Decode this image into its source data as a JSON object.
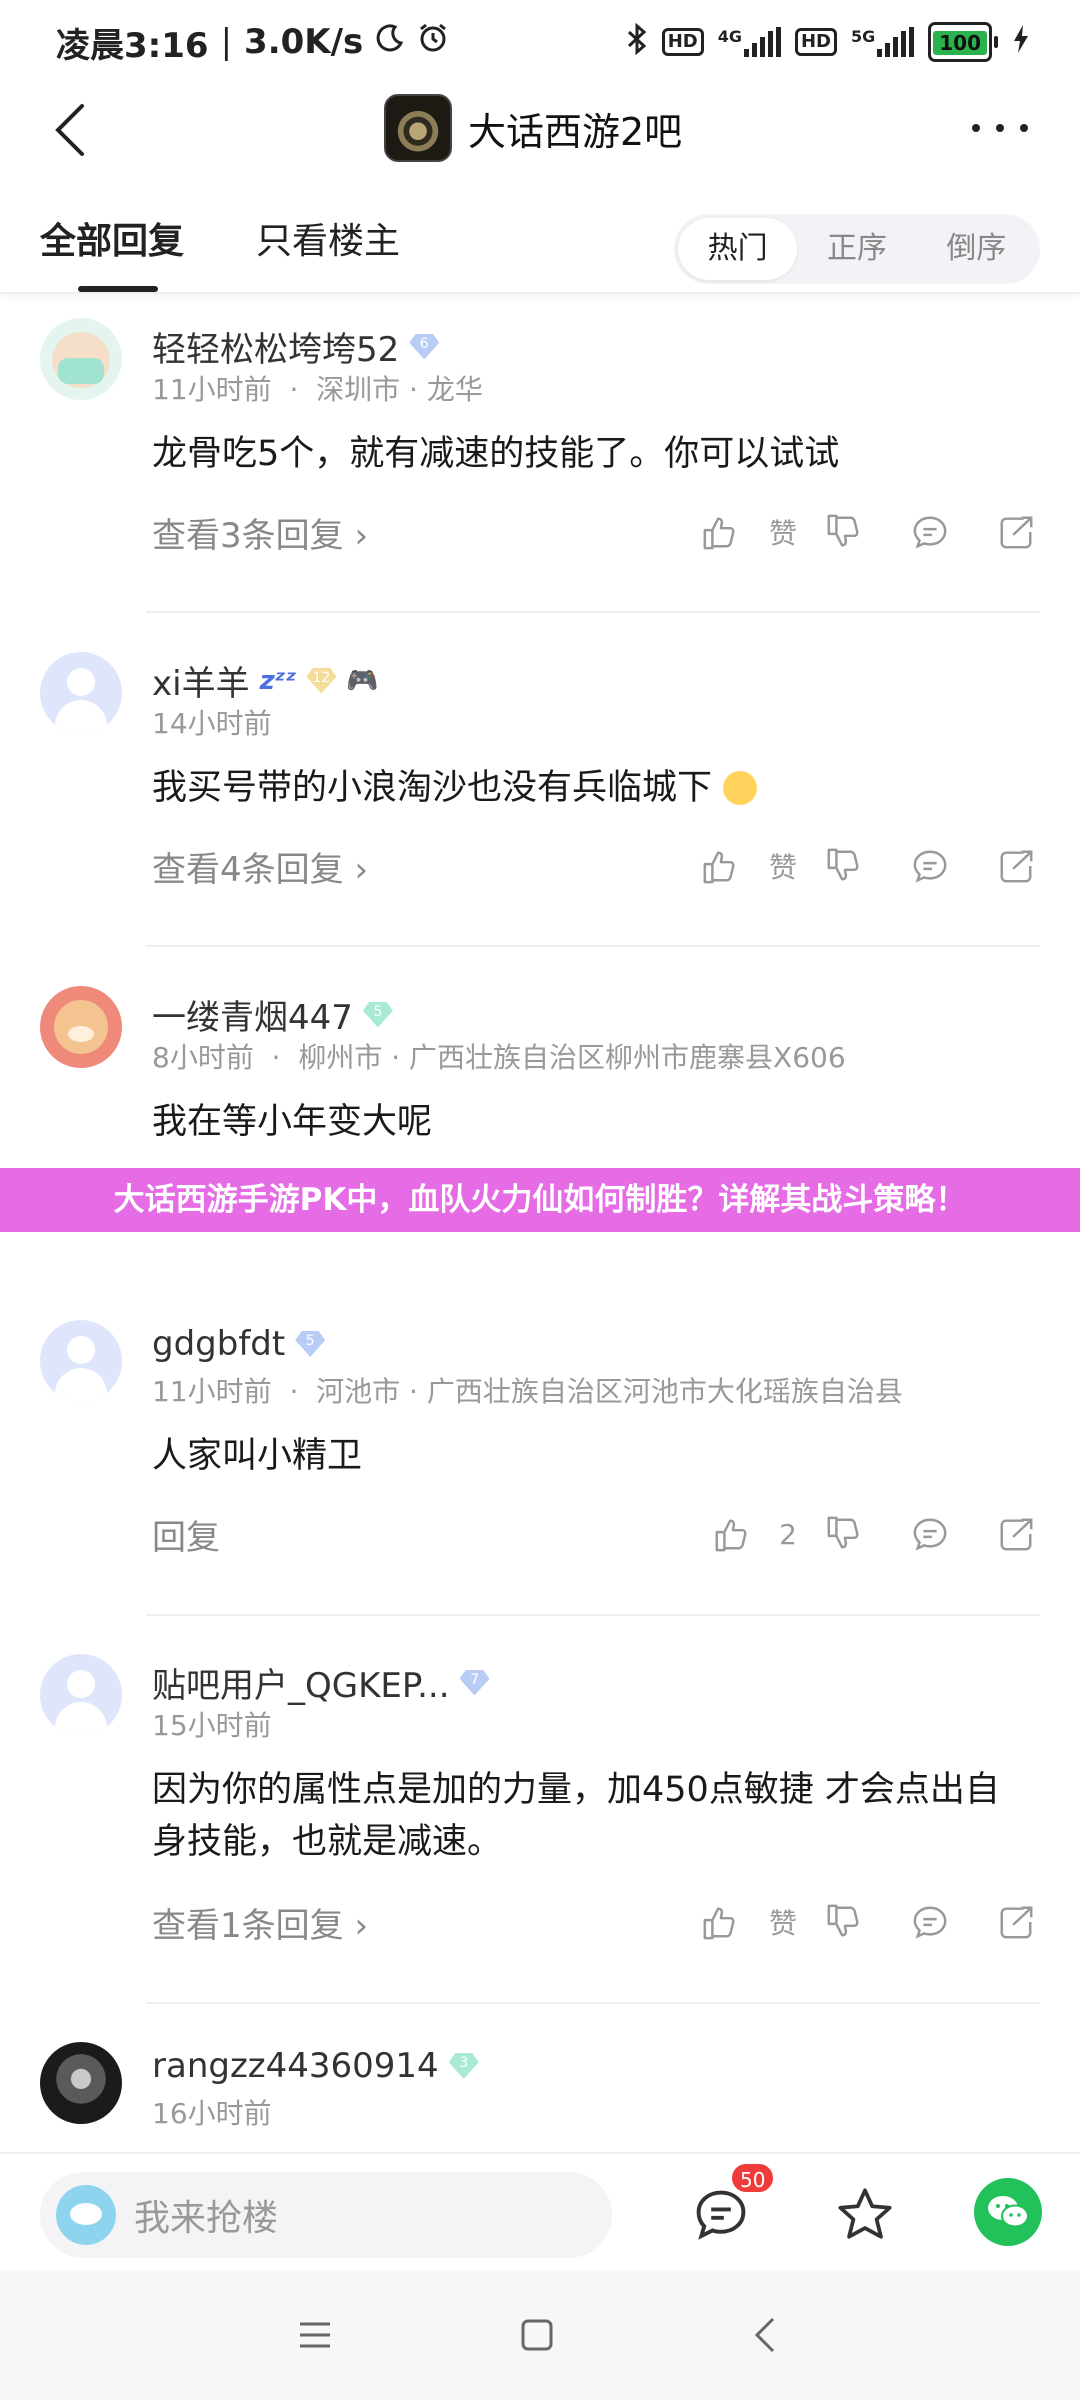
{
  "status_bar": {
    "time": "凌晨3:16",
    "net_speed": "3.0K/s",
    "battery": "100",
    "sim1_tag": "4G",
    "sim2_tag": "5G",
    "hd_label": "HD"
  },
  "nav": {
    "title": "大话西游2吧"
  },
  "tabs": {
    "all_replies": "全部回复",
    "owner_only": "只看楼主",
    "sort": [
      "热门",
      "正序",
      "倒序"
    ]
  },
  "comments": [
    {
      "username": "轻轻松松垮垮52",
      "level": "6",
      "time": "11小时前",
      "location": "深圳市 · 龙华",
      "text": "龙骨吃5个，就有减速的技能了。你可以试试",
      "reply_link": "查看3条回复 ›",
      "like_count": "赞"
    },
    {
      "username": "xi羊羊",
      "level": "12",
      "time": "14小时前",
      "location": "",
      "text": "我买号带的小浪淘沙也没有兵临城下",
      "reply_link": "查看4条回复 ›",
      "like_count": "赞"
    },
    {
      "username": "一缕青烟447",
      "level": "5",
      "time": "8小时前",
      "location": "柳州市 · 广西壮族自治区柳州市鹿寨县X606",
      "text": "我在等小年变大呢",
      "reply_link": "",
      "like_count": ""
    },
    {
      "username": "gdgbfdt",
      "level": "5",
      "time": "11小时前",
      "location": "河池市 · 广西壮族自治区河池市大化瑶族自治县",
      "text": "人家叫小精卫",
      "reply_link": "回复",
      "like_count": "2"
    },
    {
      "username": "贴吧用户_QGKEP...",
      "level": "7",
      "time": "15小时前",
      "location": "",
      "text": "因为你的属性点是加的力量，加450点敏捷 才会点出自身技能，也就是减速。",
      "reply_link": "查看1条回复 ›",
      "like_count": "赞"
    },
    {
      "username": "rangzz44360914",
      "level": "3",
      "time": "16小时前",
      "location": "",
      "text": "",
      "reply_link": "",
      "like_count": ""
    }
  ],
  "banner": {
    "text": "大话西游手游PK中，血队火力仙如何制胜？详解其战斗策略！"
  },
  "bottom_bar": {
    "input_placeholder": "我来抢楼",
    "message_badge": "50"
  },
  "colors": {
    "banner_bg": "#e56ce4",
    "wechat_green": "#22c15a",
    "badge_red": "#f03b3b",
    "battery_green": "#2bb24c"
  }
}
